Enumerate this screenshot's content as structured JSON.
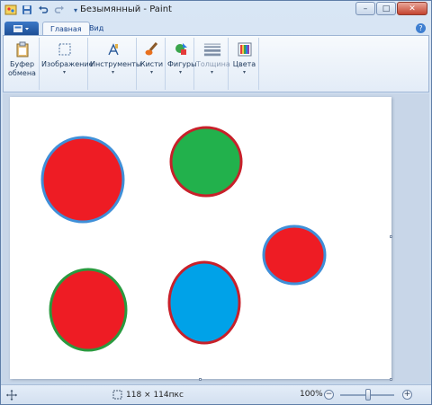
{
  "window": {
    "title": "Безымянный - Paint",
    "controls": {
      "minimize": "–",
      "maximize": "□",
      "close": "✕"
    }
  },
  "quick_access": [
    {
      "name": "paint-app-icon",
      "glyph": "🖌"
    },
    {
      "name": "save-icon",
      "glyph": "💾"
    },
    {
      "name": "undo-icon",
      "glyph": "↶"
    },
    {
      "name": "redo-icon",
      "glyph": "↷"
    },
    {
      "name": "qat-dropdown-icon",
      "glyph": "▾"
    }
  ],
  "tabs": {
    "active": "Главная",
    "view": "Вид",
    "help": "?"
  },
  "ribbon": {
    "clipboard": {
      "line1": "Буфер",
      "line2": "обмена"
    },
    "image": "Изображение",
    "tools": "Инструменты",
    "brushes": "Кисти",
    "shapes": "Фигуры",
    "thickness": "Толщина",
    "colors": "Цвета"
  },
  "status": {
    "selection_size": "118 × 114пкс",
    "zoom": "100%"
  },
  "colors": {
    "red": "#ee1c24",
    "green": "#22b14c",
    "blue": "#00a2e8",
    "blue_outline": "#3f8fd8",
    "red_outline": "#c8202a",
    "green_outline": "#2a9a3f"
  }
}
